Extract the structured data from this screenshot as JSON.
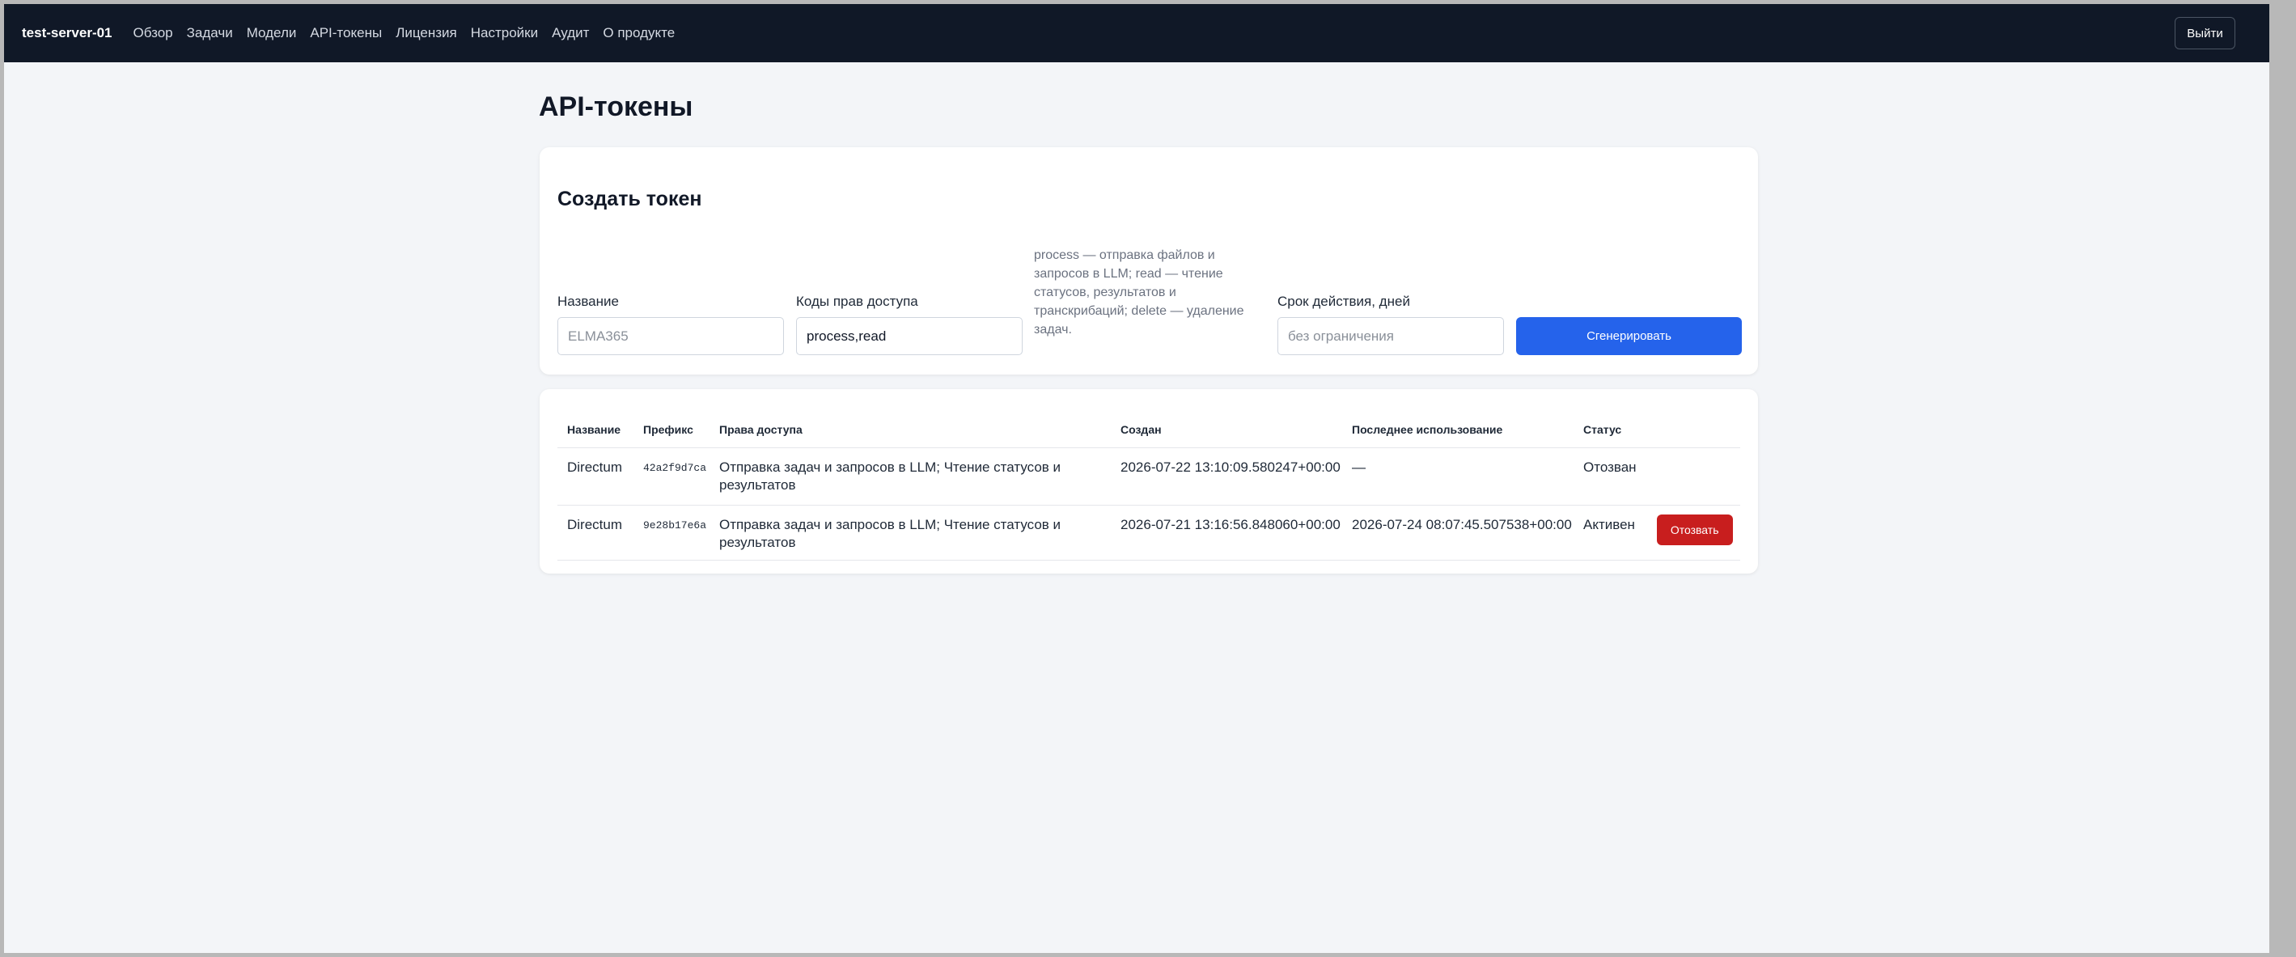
{
  "navbar": {
    "brand": "test-server-01",
    "items": [
      {
        "label": "Обзор"
      },
      {
        "label": "Задачи"
      },
      {
        "label": "Модели"
      },
      {
        "label": "API-токены"
      },
      {
        "label": "Лицензия"
      },
      {
        "label": "Настройки"
      },
      {
        "label": "Аудит"
      },
      {
        "label": "О продукте"
      }
    ],
    "logout_label": "Выйти"
  },
  "page": {
    "title": "API-токены"
  },
  "create_form": {
    "title": "Создать токен",
    "name_label": "Название",
    "name_placeholder": "ELMA365",
    "name_value": "",
    "scopes_label": "Коды прав доступа",
    "scopes_value": "process,read",
    "scopes_hint": "process — отправка файлов и запросов в LLM; read — чтение статусов, результатов и транскрибаций; delete — удаление задач.",
    "expiry_label": "Срок действия, дней",
    "expiry_placeholder": "без ограничения",
    "expiry_value": "",
    "generate_label": "Сгенерировать"
  },
  "tokens_table": {
    "columns": [
      "Название",
      "Префикс",
      "Права доступа",
      "Создан",
      "Последнее использование",
      "Статус"
    ],
    "rows": [
      {
        "name": "Directum",
        "prefix": "42a2f9d7ca",
        "scopes": "Отправка задач и запросов в LLM; Чтение статусов и результатов",
        "created": "2026-07-22 13:10:09.580247+00:00",
        "last_used": "—",
        "status": "Отозван",
        "action": ""
      },
      {
        "name": "Directum",
        "prefix": "9e28b17e6a",
        "scopes": "Отправка задач и запросов в LLM; Чтение статусов и результатов",
        "created": "2026-07-21 13:16:56.848060+00:00",
        "last_used": "2026-07-24 08:07:45.507538+00:00",
        "status": "Активен",
        "action": "Отозвать"
      }
    ]
  },
  "colors": {
    "navbar_bg": "#101827",
    "page_bg": "#f3f5f8",
    "primary": "#2563eb",
    "danger": "#c81e1e"
  }
}
